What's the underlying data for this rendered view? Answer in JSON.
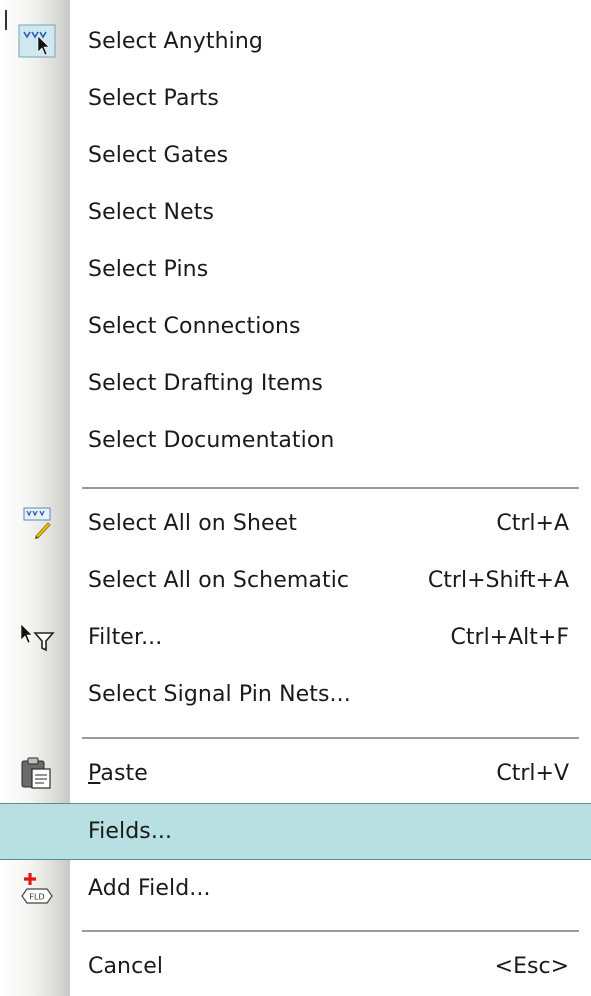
{
  "menu": {
    "items": [
      {
        "label": "Select Anything",
        "shortcut": "",
        "icon": "select-anything-icon"
      },
      {
        "label": "Select Parts",
        "shortcut": ""
      },
      {
        "label": "Select Gates",
        "shortcut": ""
      },
      {
        "label": "Select Nets",
        "shortcut": ""
      },
      {
        "label": "Select Pins",
        "shortcut": ""
      },
      {
        "label": "Select Connections",
        "shortcut": ""
      },
      {
        "label": "Select Drafting Items",
        "shortcut": ""
      },
      {
        "label": "Select Documentation",
        "shortcut": ""
      },
      {
        "label": "Select All on Sheet",
        "shortcut": "Ctrl+A",
        "icon": "select-all-icon"
      },
      {
        "label": "Select All on Schematic",
        "shortcut": "Ctrl+Shift+A"
      },
      {
        "label": "Filter...",
        "shortcut": "Ctrl+Alt+F",
        "icon": "filter-icon"
      },
      {
        "label": "Select Signal Pin Nets...",
        "shortcut": ""
      },
      {
        "label_first": "P",
        "label_rest": "aste",
        "shortcut": "Ctrl+V",
        "icon": "paste-icon"
      },
      {
        "label": "Fields...",
        "shortcut": "",
        "highlighted": true
      },
      {
        "label": "Add Field...",
        "shortcut": "",
        "icon": "add-field-icon"
      },
      {
        "label": "Cancel",
        "shortcut": "<Esc>"
      }
    ],
    "highlight_color": "#b8dfe2"
  }
}
